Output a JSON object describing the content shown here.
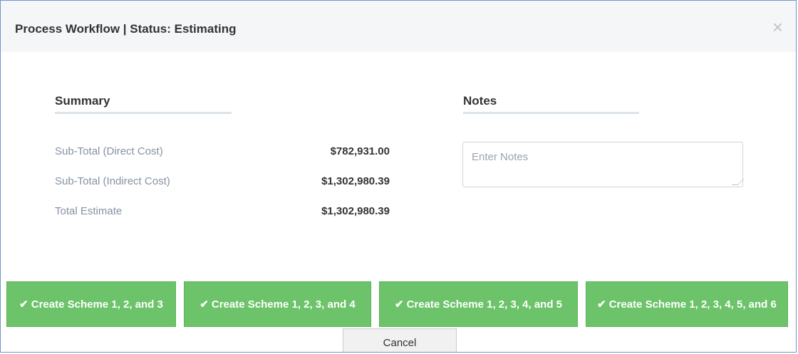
{
  "header": {
    "title": "Process Workflow | Status: Estimating",
    "close_glyph": "×"
  },
  "summary": {
    "title": "Summary",
    "rows": [
      {
        "label": "Sub-Total (Direct Cost)",
        "value": "$782,931.00"
      },
      {
        "label": "Sub-Total (Indirect Cost)",
        "value": "$1,302,980.39"
      },
      {
        "label": "Total Estimate",
        "value": "$1,302,980.39"
      }
    ]
  },
  "notes": {
    "title": "Notes",
    "placeholder": "Enter Notes"
  },
  "actions": [
    {
      "label": "Create Scheme 1, 2, and 3",
      "icon": "check-icon"
    },
    {
      "label": "Create Scheme 1, 2, 3, and 4",
      "icon": "check-icon"
    },
    {
      "label": "Create Scheme 1, 2, 3, 4, and 5",
      "icon": "check-icon"
    },
    {
      "label": "Create Scheme 1, 2, 3, 4, 5, and 6",
      "icon": "check-icon"
    }
  ],
  "cancel_label": "Cancel",
  "colors": {
    "accent_green": "#6cc36a",
    "header_bg": "#f5f6f8",
    "border_blue": "#6b97c8"
  }
}
